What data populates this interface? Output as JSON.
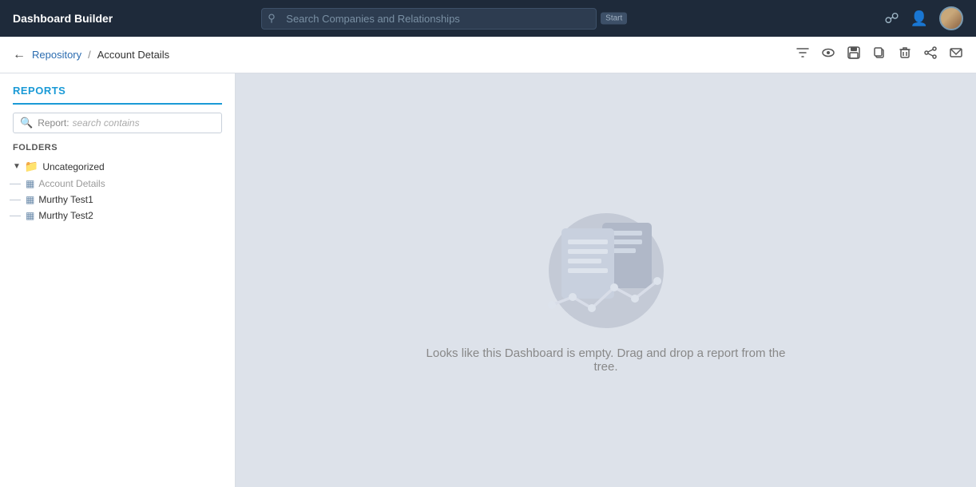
{
  "app": {
    "title": "Dashboard Builder"
  },
  "topnav": {
    "search_placeholder": "Search Companies and Relationships",
    "start_badge": "Start"
  },
  "breadcrumb": {
    "back_label": "←",
    "repository_label": "Repository",
    "separator": "/",
    "current_page": "Account Details"
  },
  "toolbar": {
    "icons": [
      "filter-icon",
      "eye-icon",
      "save-icon",
      "copy-icon",
      "delete-icon",
      "share-icon",
      "email-icon"
    ]
  },
  "sidebar": {
    "reports_label": "REPORTS",
    "search_label": "Report:",
    "search_placeholder": "search contains",
    "folders_label": "FOLDERS",
    "tree": {
      "folder_name": "Uncategorized",
      "items": [
        {
          "label": "Account Details",
          "muted": true
        },
        {
          "label": "Murthy Test1",
          "muted": false
        },
        {
          "label": "Murthy Test2",
          "muted": false
        }
      ]
    }
  },
  "content": {
    "empty_message": "Looks like this Dashboard is empty. Drag and drop a report from the tree."
  }
}
